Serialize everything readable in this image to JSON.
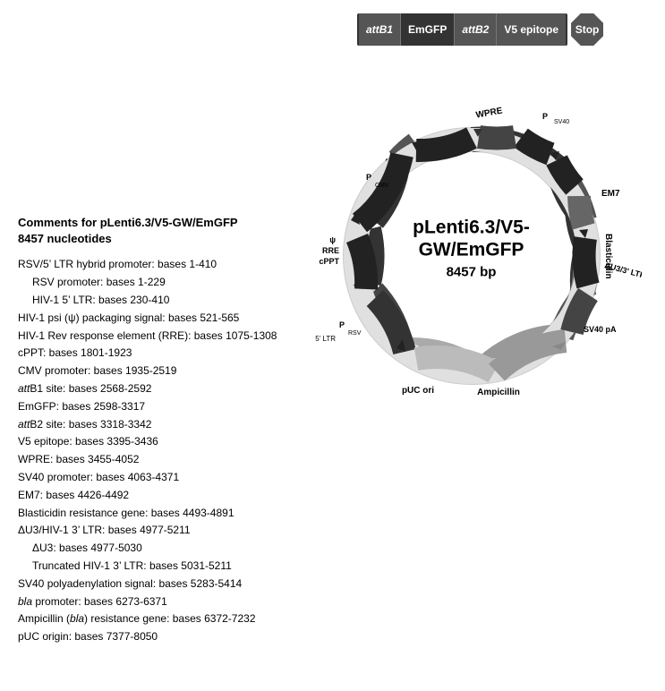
{
  "linear_map": {
    "segments": [
      {
        "id": "attb1",
        "label": "attB1",
        "italic": true
      },
      {
        "id": "emgfp",
        "label": "EmGFP",
        "italic": false
      },
      {
        "id": "attb2",
        "label": "attB2",
        "italic": true
      },
      {
        "id": "v5",
        "label": "V5 epitope",
        "italic": false
      }
    ],
    "stop_label": "Stop"
  },
  "plasmid": {
    "title": "pLenti6.3/V5-GW/EmGFP",
    "bp": "8457 bp"
  },
  "comments": {
    "title": "Comments for pLenti6.3/V5-GW/EmGFP",
    "subtitle": "8457 nucleotides",
    "entries": [
      {
        "text": "RSV/5’ LTR hybrid promoter: bases 1-410",
        "indent": 0,
        "italic": false
      },
      {
        "text": "RSV promoter: bases 1-229",
        "indent": 1,
        "italic": false
      },
      {
        "text": "HIV-1 5’ LTR: bases 230-410",
        "indent": 1,
        "italic": false
      },
      {
        "text": "HIV-1 psi (ψ) packaging signal: bases 521-565",
        "indent": 0,
        "italic": false
      },
      {
        "text": "HIV-1 Rev response element (RRE): bases 1075-1308",
        "indent": 0,
        "italic": false
      },
      {
        "text": "cPPT: bases 1801-1923",
        "indent": 0,
        "italic": false
      },
      {
        "text": "CMV promoter: bases 1935-2519",
        "indent": 0,
        "italic": false
      },
      {
        "text": "attB1 site: bases 2568-2592",
        "indent": 0,
        "italic": true,
        "prefix": "att",
        "suffix": "B1 site: bases 2568-2592"
      },
      {
        "text": "EmGFP: bases 2598-3317",
        "indent": 0,
        "italic": false
      },
      {
        "text": "attB2 site: bases 3318-3342",
        "indent": 0,
        "italic": true,
        "prefix": "att",
        "suffix": "B2 site: bases 3318-3342"
      },
      {
        "text": "V5 epitope: bases 3395-3436",
        "indent": 0,
        "italic": false
      },
      {
        "text": "WPRE: bases 3455-4052",
        "indent": 0,
        "italic": false
      },
      {
        "text": "SV40 promoter: bases 4063-4371",
        "indent": 0,
        "italic": false
      },
      {
        "text": "EM7: bases 4426-4492",
        "indent": 0,
        "italic": false
      },
      {
        "text": "Blasticidin resistance gene: bases 4493-4891",
        "indent": 0,
        "italic": false
      },
      {
        "text": "ΔU3/HIV-1 3’ LTR: bases 4977-5211",
        "indent": 0,
        "italic": false
      },
      {
        "text": "ΔU3: bases 4977-5030",
        "indent": 1,
        "italic": false
      },
      {
        "text": "Truncated HIV-1 3’ LTR: bases 5031-5211",
        "indent": 1,
        "italic": false
      },
      {
        "text": "SV40 polyadenylation signal: bases 5283-5414",
        "indent": 0,
        "italic": false
      },
      {
        "text": "bla promoter: bases 6273-6371",
        "indent": 0,
        "italic": true,
        "prefix": "bla",
        "suffix": " promoter: bases 6273-6371"
      },
      {
        "text": "Ampicillin (bla) resistance gene: bases 6372-7232",
        "indent": 0,
        "italic": false,
        "italic_part": "bla"
      },
      {
        "text": "pUC origin: bases 7377-8050",
        "indent": 0,
        "italic": false
      }
    ]
  }
}
